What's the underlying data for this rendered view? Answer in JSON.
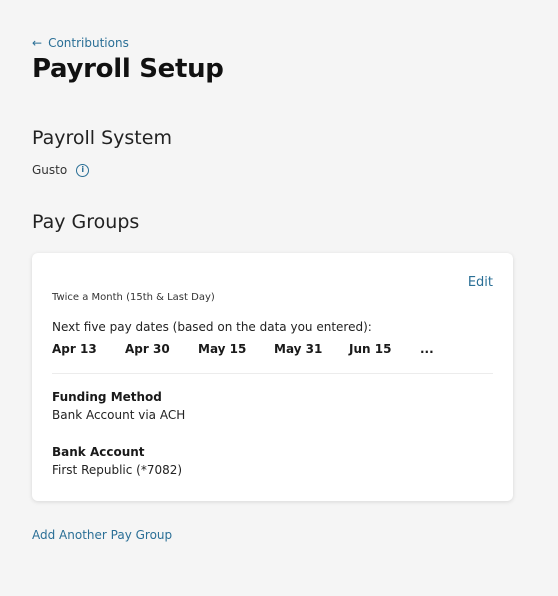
{
  "nav": {
    "back_label": "Contributions",
    "back_icon": "arrow-left-icon"
  },
  "page": {
    "title": "Payroll Setup"
  },
  "payroll_system": {
    "heading": "Payroll System",
    "value": "Gusto",
    "info_icon_glyph": "i"
  },
  "pay_groups": {
    "heading": "Pay Groups",
    "card": {
      "edit_label": "Edit",
      "frequency": "Twice a Month (15th & Last Day)",
      "next_dates_label": "Next five pay dates (based on the data you entered):",
      "dates": [
        "Apr 13",
        "Apr 30",
        "May 15",
        "May 31",
        "Jun 15",
        "..."
      ],
      "funding_method_label": "Funding Method",
      "funding_method_value": "Bank Account via ACH",
      "bank_account_label": "Bank Account",
      "bank_account_value": "First Republic (*7082)"
    },
    "add_label": "Add Another Pay Group"
  },
  "colors": {
    "background": "#f5f5f5",
    "card": "#ffffff",
    "link": "#2a6f96",
    "text": "#1f1f1f"
  }
}
